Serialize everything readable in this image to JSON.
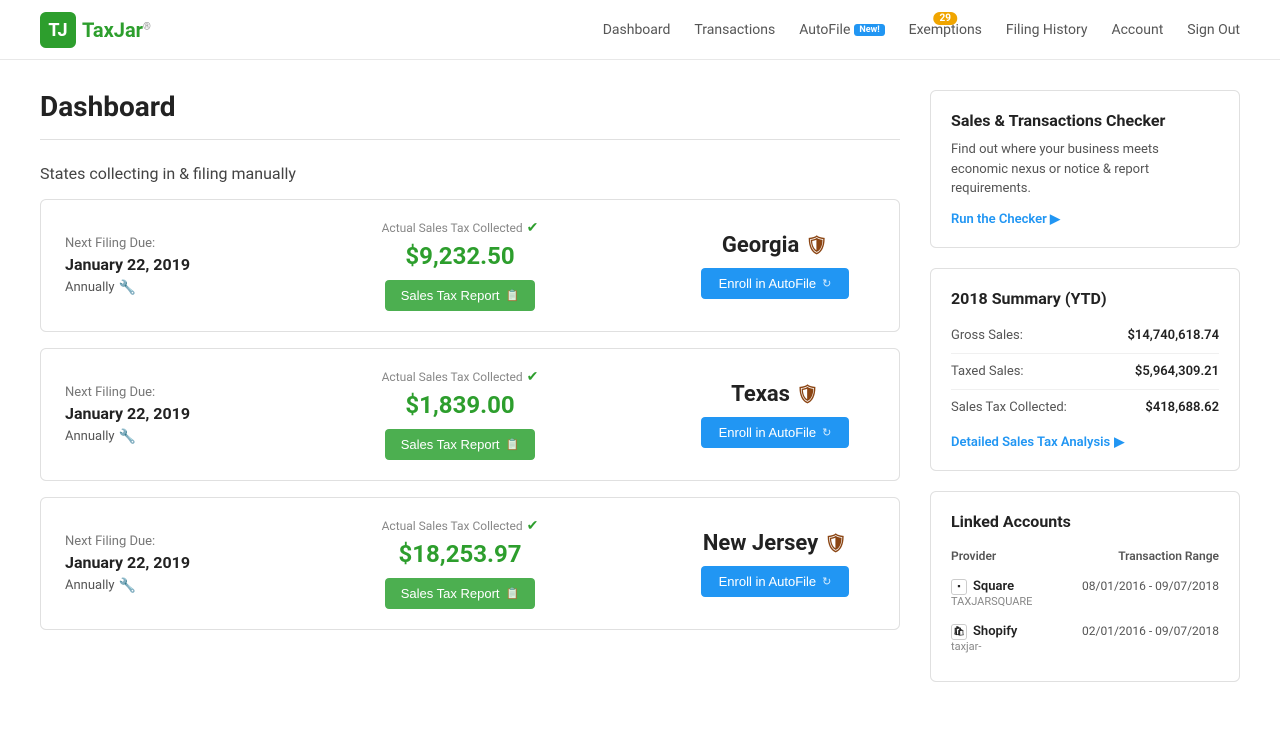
{
  "nav": {
    "logo_text": "TaxJar",
    "links": [
      {
        "id": "dashboard",
        "label": "Dashboard",
        "badge": null
      },
      {
        "id": "transactions",
        "label": "Transactions",
        "badge": null
      },
      {
        "id": "autofile",
        "label": "AutoFile",
        "badge": "New!",
        "badge_color": "#2196f3"
      },
      {
        "id": "exemptions",
        "label": "Exemptions",
        "badge": "29",
        "badge_color": "#f0a500"
      },
      {
        "id": "filing-history",
        "label": "Filing History",
        "badge": null
      },
      {
        "id": "account",
        "label": "Account",
        "badge": null
      },
      {
        "id": "sign-out",
        "label": "Sign Out",
        "badge": null
      }
    ]
  },
  "page": {
    "title": "Dashboard",
    "section_title": "States collecting in & filing manually"
  },
  "states": [
    {
      "id": "georgia",
      "next_filing_label": "Next Filing Due:",
      "next_filing_date": "January 22, 2019",
      "frequency": "Annually",
      "tax_collected_label": "Actual Sales Tax Collected",
      "tax_amount": "$9,232.50",
      "report_btn": "Sales Tax Report",
      "state_name": "Georgia",
      "autofile_btn": "Enroll in AutoFile"
    },
    {
      "id": "texas",
      "next_filing_label": "Next Filing Due:",
      "next_filing_date": "January 22, 2019",
      "frequency": "Annually",
      "tax_collected_label": "Actual Sales Tax Collected",
      "tax_amount": "$1,839.00",
      "report_btn": "Sales Tax Report",
      "state_name": "Texas",
      "autofile_btn": "Enroll in AutoFile"
    },
    {
      "id": "new-jersey",
      "next_filing_label": "Next Filing Due:",
      "next_filing_date": "January 22, 2019",
      "frequency": "Annually",
      "tax_collected_label": "Actual Sales Tax Collected",
      "tax_amount": "$18,253.97",
      "report_btn": "Sales Tax Report",
      "state_name": "New Jersey",
      "autofile_btn": "Enroll in AutoFile"
    }
  ],
  "checker": {
    "title": "Sales & Transactions Checker",
    "description": "Find out where your business meets economic nexus or notice & report requirements.",
    "link": "Run the Checker",
    "link_arrow": "▶"
  },
  "summary": {
    "title": "2018 Summary (YTD)",
    "rows": [
      {
        "label": "Gross Sales:",
        "value": "$14,740,618.74"
      },
      {
        "label": "Taxed Sales:",
        "value": "$5,964,309.21"
      },
      {
        "label": "Sales Tax Collected:",
        "value": "$418,688.62"
      }
    ],
    "analysis_link": "Detailed Sales Tax Analysis",
    "analysis_arrow": "▶"
  },
  "linked_accounts": {
    "title": "Linked Accounts",
    "col_provider": "Provider",
    "col_range": "Transaction Range",
    "accounts": [
      {
        "id": "square",
        "icon": "▪",
        "name": "Square",
        "sub": "TAXJARSQUARE",
        "range": "08/01/2016 - 09/07/2018"
      },
      {
        "id": "shopify",
        "icon": "🛍",
        "name": "Shopify",
        "sub": "taxjar-",
        "range": "02/01/2016 - 09/07/2018"
      }
    ]
  }
}
